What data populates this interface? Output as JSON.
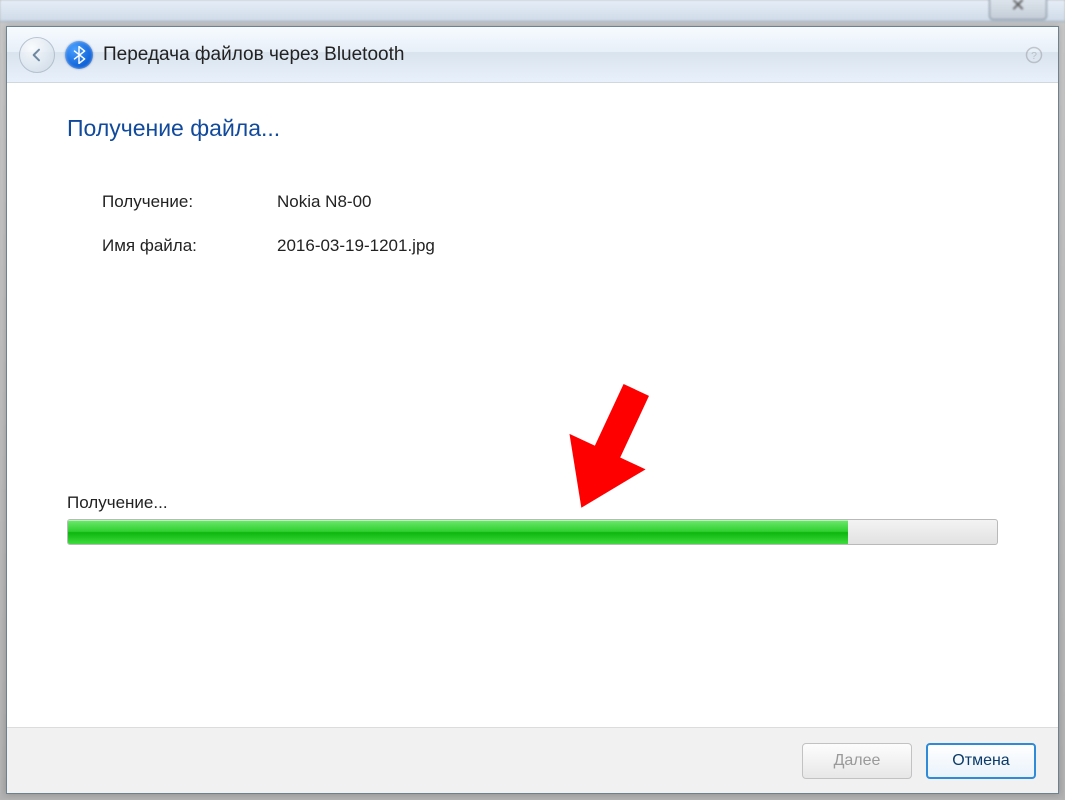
{
  "background_window": {
    "close_glyph": "✕"
  },
  "dialog": {
    "title": "Передача файлов через Bluetooth"
  },
  "content": {
    "heading": "Получение файла...",
    "source_label": "Получение:",
    "source_value": "Nokia N8-00",
    "filename_label": "Имя файла:",
    "filename_value": "2016-03-19-1201.jpg"
  },
  "progress": {
    "label": "Получение...",
    "percent": 84
  },
  "footer": {
    "next_label": "Далее",
    "cancel_label": "Отмена"
  },
  "colors": {
    "heading": "#114a9c",
    "progress_fill": "#2ecf2e",
    "primary_border": "#2f8bd8",
    "annotation": "#ff0000"
  }
}
